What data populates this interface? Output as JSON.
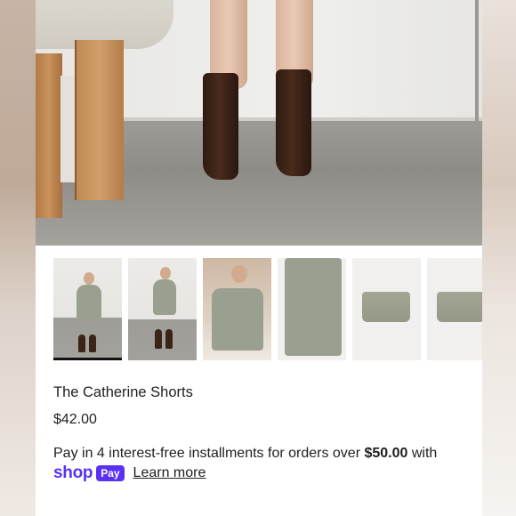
{
  "product": {
    "title": "The Catherine Shorts",
    "price": "$42.00"
  },
  "gallery": {
    "main_image": "product-hero-boots-photo",
    "thumbnails": [
      {
        "label": "thumbnail-1",
        "selected": true
      },
      {
        "label": "thumbnail-2",
        "selected": false
      },
      {
        "label": "thumbnail-3",
        "selected": false
      },
      {
        "label": "thumbnail-4",
        "selected": false
      },
      {
        "label": "thumbnail-5",
        "selected": false
      },
      {
        "label": "thumbnail-6",
        "selected": false
      }
    ]
  },
  "installments": {
    "text_before": "Pay in 4 interest-free installments for orders over ",
    "threshold": "$50.00",
    "text_after": " with",
    "shop_logo": "shop",
    "pay_badge": "Pay",
    "learn_more": "Learn more"
  },
  "colors": {
    "shop_purple": "#5a31f4",
    "text": "#1f1f1f"
  }
}
